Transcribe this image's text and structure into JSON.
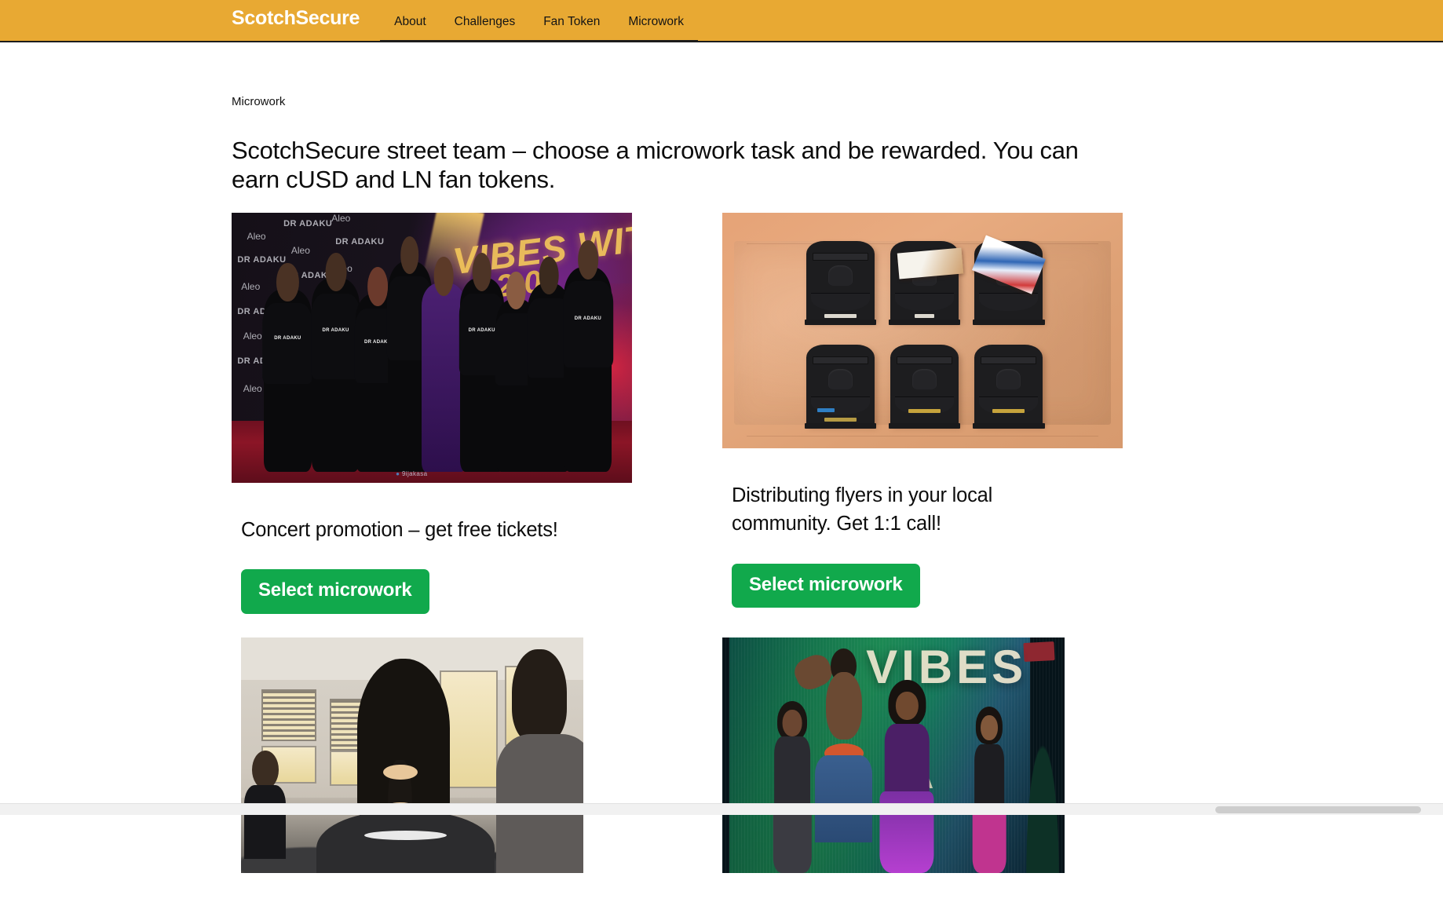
{
  "header": {
    "brand": "ScotchSecure",
    "brand_color": "#ffffff",
    "bar_color": "#e8a933",
    "nav_items": [
      {
        "label": "About"
      },
      {
        "label": "Challenges"
      },
      {
        "label": "Fan Token"
      },
      {
        "label": "Microwork"
      }
    ]
  },
  "page": {
    "breadcrumb": "Microwork",
    "headline": "ScotchSecure street team – choose a microwork task and be rewarded. You can earn cUSD and LN fan tokens."
  },
  "cards": [
    {
      "title": "Concert promotion – get free tickets!",
      "button_label": "Select microwork",
      "button_color": "#11a94c",
      "image_alt": "Group of people in black DR ADAKU t-shirts posing on a red carpet in front of a Vibes With 2.0 step-and-repeat backdrop",
      "image_overlay_text": [
        "Aleo",
        "DR ADAKU",
        "VIBES WITH",
        "2.0"
      ]
    },
    {
      "title": "Distributing flyers in your local community. Get 1:1 call!",
      "button_label": "Select microwork",
      "button_color": "#11a94c",
      "image_alt": "Six black mailboxes mounted on a terracotta stucco wall, two with flyers sticking out"
    },
    {
      "title": "",
      "button_label": "",
      "image_alt": "Back view of a woman with a long braid with gold hair ties facing a crowded classroom, a man in a grey shirt on the right"
    },
    {
      "title": "",
      "button_label": "",
      "image_alt": "Three dancers performing on stage in front of a large green VIBES LED screen",
      "image_overlay_text": [
        "VIBES"
      ]
    }
  ],
  "scrollbar": {
    "orientation": "horizontal",
    "track_color": "#f1f1f1",
    "thumb_color": "#cdcdcd"
  }
}
